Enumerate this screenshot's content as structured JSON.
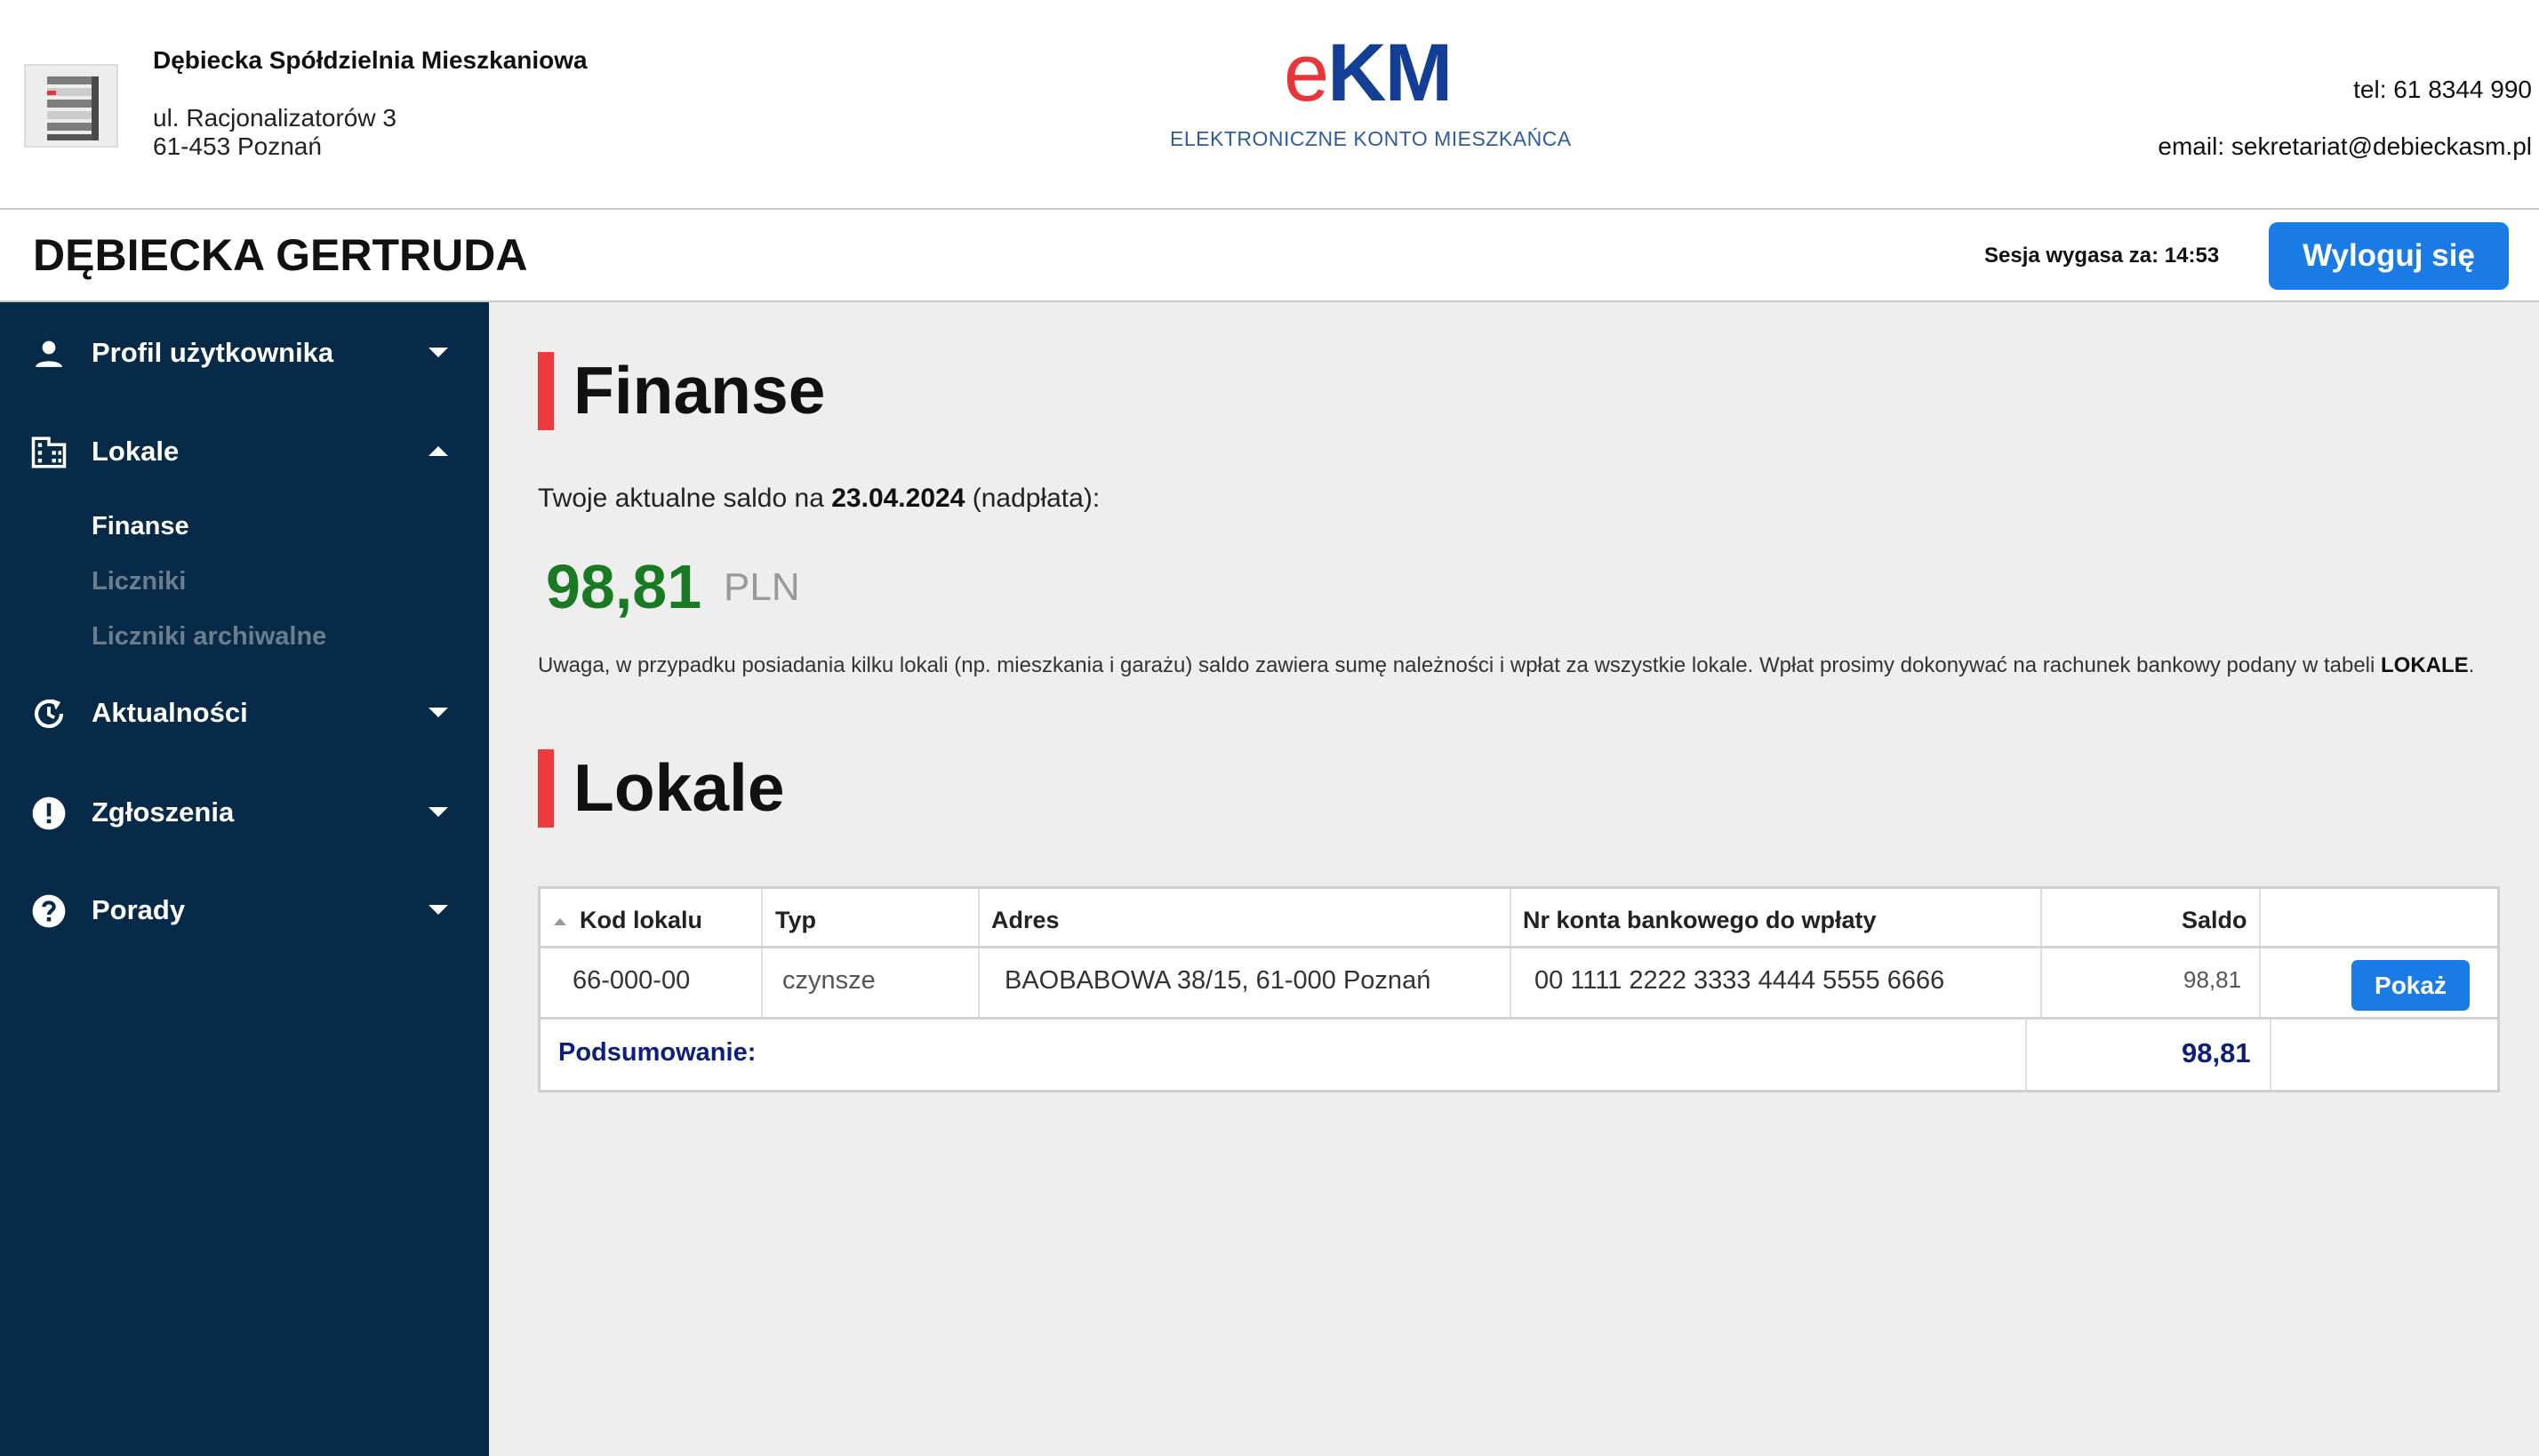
{
  "header": {
    "coop_name": "Dębiecka Spółdzielnia Mieszkaniowa",
    "street": "ul. Racjonalizatorów 3",
    "city": "61-453 Poznań",
    "brand_e": "e",
    "brand_km": "KM",
    "brand_subtitle": "ELEKTRONICZNE KONTO MIESZKAŃCA",
    "tel": "tel: 61 8344 990",
    "email": "email: sekretariat@debieckasm.pl"
  },
  "user_bar": {
    "user_name": "DĘBIECKA GERTRUDA",
    "session": "Sesja wygasa za: 14:53",
    "logout_label": "Wyloguj się"
  },
  "sidebar": {
    "items": [
      {
        "label": "Profil użytkownika",
        "icon": "user-icon",
        "expanded": false
      },
      {
        "label": "Lokale",
        "icon": "building-icon",
        "expanded": true
      },
      {
        "label": "Aktualności",
        "icon": "history-icon",
        "expanded": false
      },
      {
        "label": "Zgłoszenia",
        "icon": "alert-icon",
        "expanded": false
      },
      {
        "label": "Porady",
        "icon": "help-icon",
        "expanded": false
      }
    ],
    "sub_items": [
      {
        "label": "Finanse",
        "active": true
      },
      {
        "label": "Liczniki",
        "active": false
      },
      {
        "label": "Liczniki archiwalne",
        "active": false
      }
    ]
  },
  "finanse": {
    "title": "Finanse",
    "saldo_prefix": "Twoje aktualne saldo na ",
    "saldo_date": "23.04.2024",
    "saldo_suffix": " (nadpłata):",
    "saldo_amount": "98,81",
    "currency": "PLN",
    "note_text": "Uwaga, w przypadku posiadania kilku lokali (np. mieszkania i garażu) saldo zawiera sumę należności i wpłat za wszystkie lokale. Wpłat prosimy dokonywać na rachunek bankowy podany w tabeli ",
    "note_bold": "LOKALE",
    "note_end": "."
  },
  "lokale": {
    "title": "Lokale",
    "columns": [
      "Kod lokalu",
      "Typ",
      "Adres",
      "Nr konta bankowego do wpłaty",
      "Saldo"
    ],
    "rows": [
      {
        "kod": "66-000-00",
        "typ": "czynsze",
        "adres": "BAOBABOWA 38/15, 61-000 Poznań",
        "konto": "00 1111 2222 3333 4444 5555 6666",
        "saldo": "98,81",
        "action": "Pokaż"
      }
    ],
    "summary_label": "Podsumowanie:",
    "summary_value": "98,81"
  },
  "colors": {
    "sidebar_bg": "#072a48",
    "accent_blue": "#1a7be6",
    "brand_red": "#e8353a",
    "brand_blue": "#123e95",
    "saldo_green": "#1a7a24",
    "section_marker": "#ee3a3a",
    "summary_text": "#0e1f7a"
  }
}
